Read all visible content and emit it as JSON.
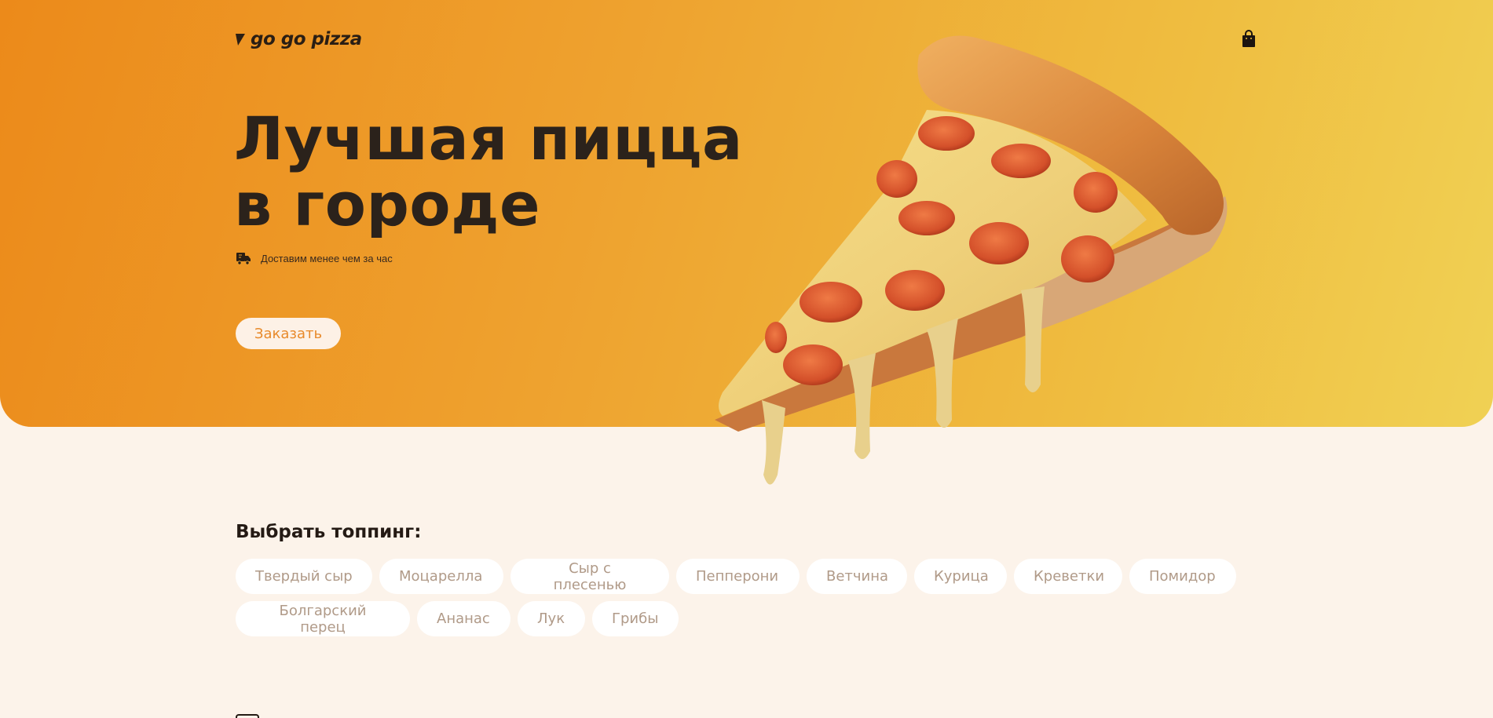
{
  "header": {
    "logo_text": "go go pizza",
    "logo_icon": "pizza-slice-mark-icon",
    "cart_icon": "shopping-bag-icon"
  },
  "hero": {
    "title_line1": "Лучшая пицца",
    "title_line2": "в городе",
    "delivery_icon": "delivery-truck-icon",
    "delivery_text": "Доставим менее чем за час",
    "order_button": "Заказать",
    "image": "pepperoni-pizza-slice-image"
  },
  "toppings": {
    "title": "Выбрать топпинг:",
    "items": [
      "Твердый сыр",
      "Моцарелла",
      "Сыр с плесенью",
      "Пепперони",
      "Ветчина",
      "Курица",
      "Креветки",
      "Помидор",
      "Болгарский перец",
      "Ананас",
      "Лук",
      "Грибы"
    ]
  },
  "colors": {
    "hero_start": "#ec8a1a",
    "hero_end": "#f0d154",
    "page_background": "#fcf3ea",
    "accent": "#e88a2b",
    "text_dark": "#2b221b",
    "chip_text": "#b09a88"
  }
}
